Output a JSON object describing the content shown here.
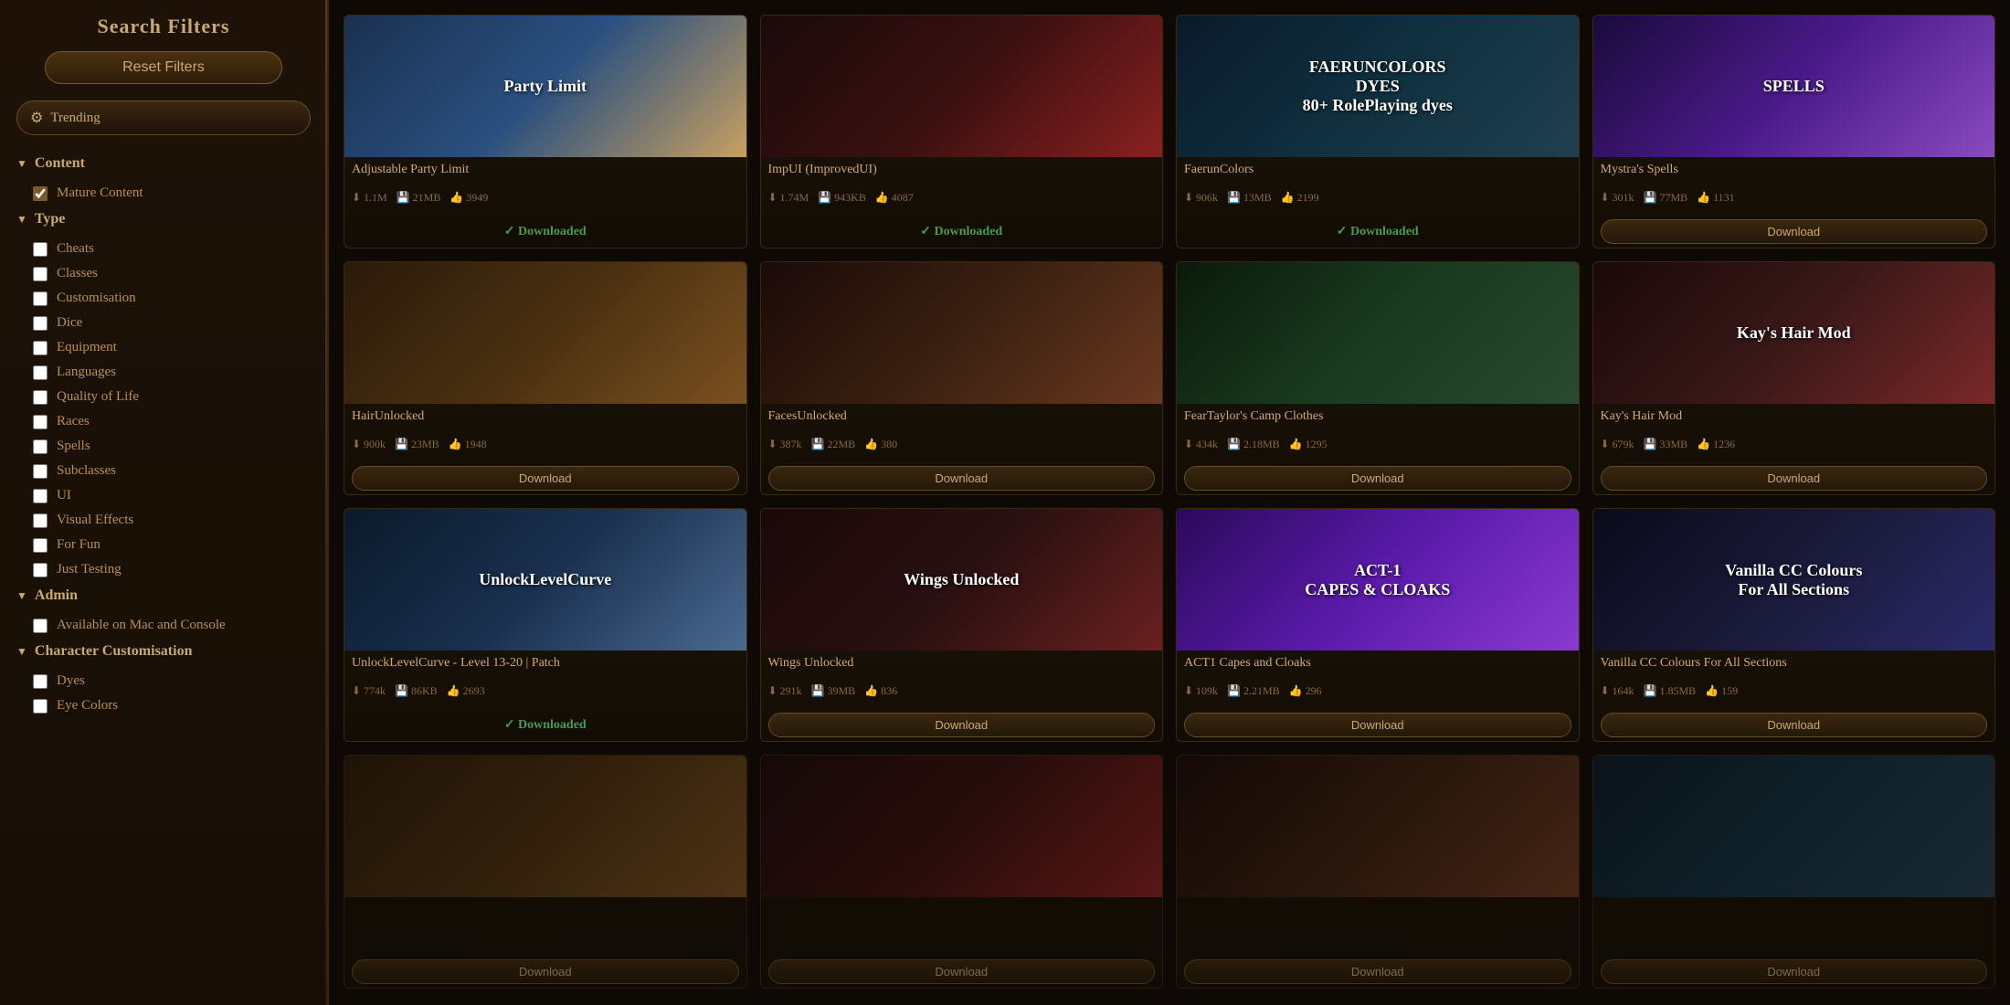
{
  "sidebar": {
    "title": "Search Filters",
    "reset_label": "Reset Filters",
    "trending_label": "Trending",
    "sections": {
      "content": {
        "label": "Content",
        "items": [
          {
            "label": "Mature Content",
            "checked": true
          }
        ]
      },
      "type": {
        "label": "Type",
        "items": [
          {
            "label": "Cheats",
            "checked": false
          },
          {
            "label": "Classes",
            "checked": false
          },
          {
            "label": "Customisation",
            "checked": false
          },
          {
            "label": "Dice",
            "checked": false
          },
          {
            "label": "Equipment",
            "checked": false
          },
          {
            "label": "Languages",
            "checked": false
          },
          {
            "label": "Quality of Life",
            "checked": false
          },
          {
            "label": "Races",
            "checked": false
          },
          {
            "label": "Spells",
            "checked": false
          },
          {
            "label": "Subclasses",
            "checked": false
          },
          {
            "label": "UI",
            "checked": false
          },
          {
            "label": "Visual Effects",
            "checked": false
          },
          {
            "label": "For Fun",
            "checked": false
          },
          {
            "label": "Just Testing",
            "checked": false
          }
        ]
      },
      "admin": {
        "label": "Admin",
        "items": [
          {
            "label": "Available on Mac and Console",
            "checked": false
          }
        ]
      },
      "character_customisation": {
        "label": "Character Customisation",
        "items": [
          {
            "label": "Dyes",
            "checked": false
          },
          {
            "label": "Eye Colors",
            "checked": false
          }
        ]
      }
    }
  },
  "mods": [
    {
      "id": "adjustable-party-limit",
      "name": "Adjustable Party Limit",
      "downloads": "1.1M",
      "size": "21MB",
      "likes": "3949",
      "status": "Downloaded",
      "thumb_class": "thumb-blue",
      "thumb_label": "Party Limit"
    },
    {
      "id": "impui",
      "name": "ImpUI (ImprovedUI)",
      "downloads": "1.74M",
      "size": "943KB",
      "likes": "4087",
      "status": "Downloaded",
      "thumb_class": "thumb-dark",
      "thumb_label": ""
    },
    {
      "id": "faeruncolors",
      "name": "FaerunColors",
      "downloads": "906k",
      "size": "13MB",
      "likes": "2199",
      "status": "Downloaded",
      "thumb_class": "thumb-teal",
      "thumb_label": "FAERUNCOLORS\nDYES\n80+ RolePlaying dyes"
    },
    {
      "id": "mystras-spells",
      "name": "Mystra's Spells",
      "downloads": "301k",
      "size": "77MB",
      "likes": "1131",
      "status": "Download",
      "thumb_class": "thumb-purple",
      "thumb_label": "SPELLS"
    },
    {
      "id": "hairunlocked",
      "name": "HairUnlocked",
      "downloads": "900k",
      "size": "23MB",
      "likes": "1948",
      "status": "Download",
      "thumb_class": "thumb-gold",
      "thumb_label": ""
    },
    {
      "id": "facesunlocked",
      "name": "FacesUnlocked",
      "downloads": "387k",
      "size": "22MB",
      "likes": "380",
      "status": "Download",
      "thumb_class": "thumb-faces",
      "thumb_label": ""
    },
    {
      "id": "feartaylor-camp-clothes",
      "name": "FearTaylor's Camp Clothes",
      "downloads": "434k",
      "size": "2.18MB",
      "likes": "1295",
      "status": "Download",
      "thumb_class": "thumb-clothes",
      "thumb_label": ""
    },
    {
      "id": "kays-hair-mod",
      "name": "Kay's Hair Mod",
      "downloads": "679k",
      "size": "33MB",
      "likes": "1236",
      "status": "Download",
      "thumb_class": "thumb-hair",
      "thumb_label": "Kay's Hair Mod"
    },
    {
      "id": "unlocklevelcurve",
      "name": "UnlockLevelCurve - Level 13-20 | Patch",
      "downloads": "774k",
      "size": "86KB",
      "likes": "2693",
      "status": "Downloaded",
      "thumb_class": "thumb-level",
      "thumb_label": "UnlockLevelCurve"
    },
    {
      "id": "wings-unlocked",
      "name": "Wings Unlocked",
      "downloads": "291k",
      "size": "39MB",
      "likes": "836",
      "status": "Download",
      "thumb_class": "thumb-wings",
      "thumb_label": "Wings Unlocked"
    },
    {
      "id": "act1-capes",
      "name": "ACT1 Capes and Cloaks",
      "downloads": "109k",
      "size": "2.21MB",
      "likes": "296",
      "status": "Download",
      "thumb_class": "thumb-capes",
      "thumb_label": "ACT-1\nCAPES & CLOAKS"
    },
    {
      "id": "vanilla-cc-colours",
      "name": "Vanilla CC Colours For All Sections",
      "downloads": "164k",
      "size": "1.85MB",
      "likes": "159",
      "status": "Download",
      "thumb_class": "thumb-vanilla",
      "thumb_label": "Vanilla CC Colours\nFor All Sections"
    },
    {
      "id": "partial-1",
      "name": "",
      "downloads": "",
      "size": "",
      "likes": "",
      "status": "Download",
      "thumb_class": "thumb-gold",
      "thumb_label": "",
      "partial": true
    },
    {
      "id": "partial-2",
      "name": "",
      "downloads": "",
      "size": "",
      "likes": "",
      "status": "Download",
      "thumb_class": "thumb-dark",
      "thumb_label": "",
      "partial": true
    },
    {
      "id": "partial-3",
      "name": "",
      "downloads": "",
      "size": "",
      "likes": "",
      "status": "Download",
      "thumb_class": "thumb-faces",
      "thumb_label": "",
      "partial": true
    },
    {
      "id": "partial-4",
      "name": "",
      "downloads": "",
      "size": "",
      "likes": "",
      "status": "Download",
      "thumb_class": "thumb-teal",
      "thumb_label": "",
      "partial": true
    }
  ]
}
